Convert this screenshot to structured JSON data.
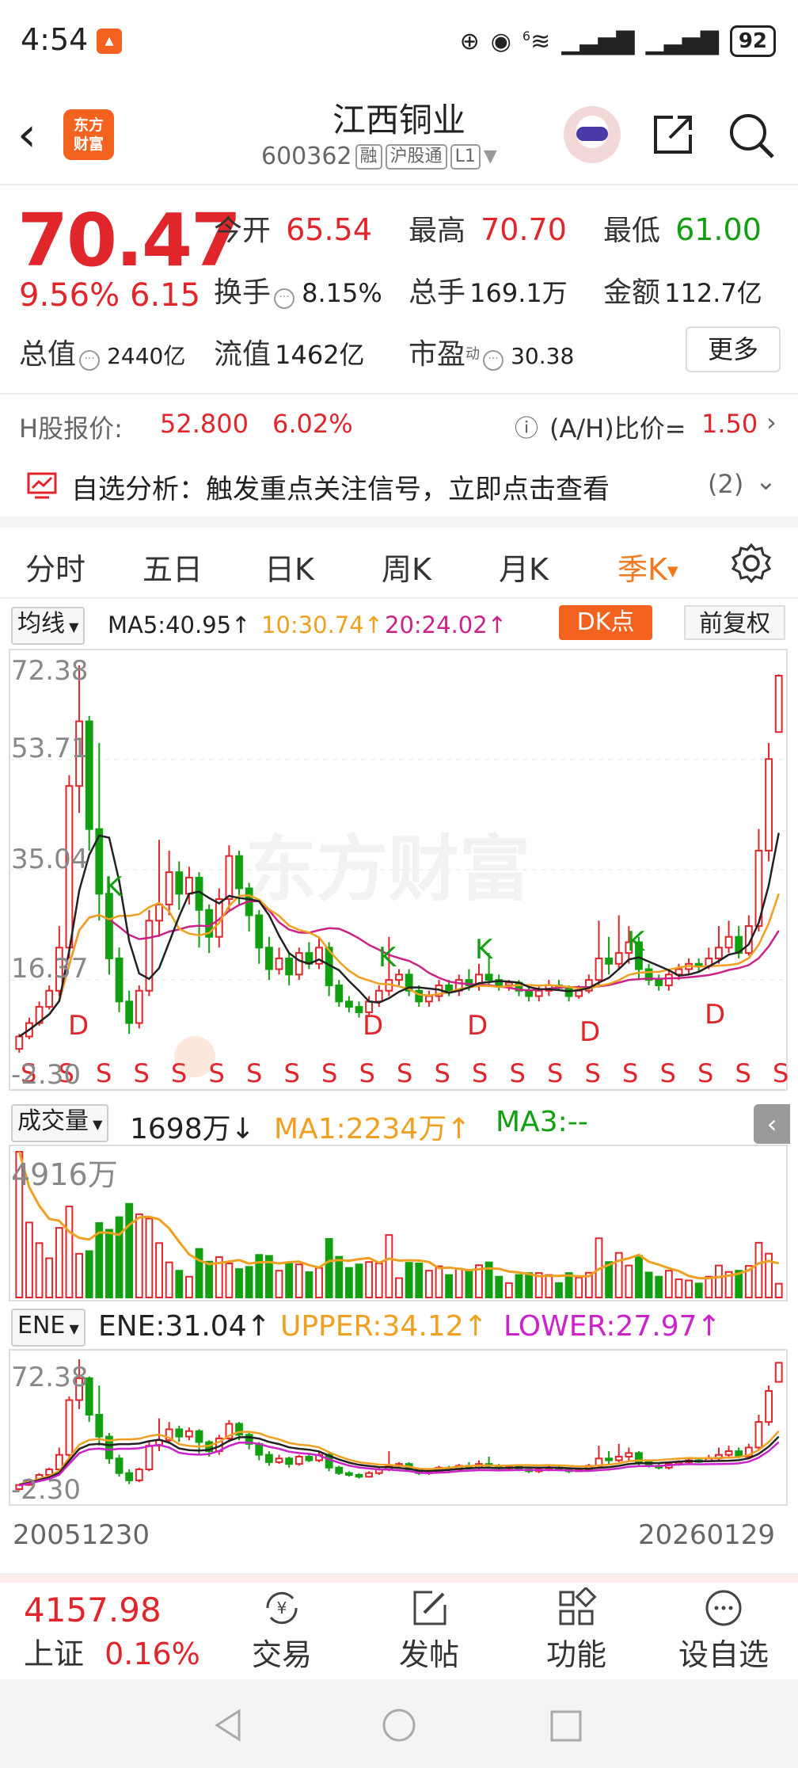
{
  "status_bar": {
    "time": "4:54",
    "network": "6",
    "battery": "92"
  },
  "header": {
    "brand_line1": "东方",
    "brand_line2": "财富",
    "stock_name": "江西铜业",
    "stock_code": "600362",
    "tags": [
      "融",
      "沪股通",
      "L1"
    ]
  },
  "quote": {
    "price": "70.47",
    "change_pct": "9.56%",
    "change_amt": "6.15",
    "open_label": "今开",
    "open": "65.54",
    "high_label": "最高",
    "high": "70.70",
    "low_label": "最低",
    "low": "61.00",
    "turnover_label": "换手",
    "turnover": "8.15%",
    "volume_label": "总手",
    "volume": "169.1万",
    "amount_label": "金额",
    "amount": "112.7亿",
    "mktcap_label": "总值",
    "mktcap": "2440亿",
    "float_label": "流值",
    "float_cap": "1462亿",
    "pe_label": "市盈",
    "pe_sup": "动",
    "pe": "30.38",
    "more_label": "更多"
  },
  "hshare": {
    "label": "H股报价:",
    "price": "52.800",
    "pct": "6.02%",
    "ratio_label": "(A/H)比价=",
    "ratio": "1.50"
  },
  "analysis": {
    "text": "自选分析：触发重点关注信号，立即点击查看",
    "count": "(2)"
  },
  "period_tabs": [
    "分时",
    "五日",
    "日K",
    "周K",
    "月K",
    "季K"
  ],
  "active_tab": "季K",
  "ma_legend": {
    "dropdown": "均线",
    "ma5": "MA5:40.95↑",
    "ma10": "10:30.74↑",
    "ma20": "20:24.02↑",
    "dk_label": "DK点",
    "adjust_label": "前复权"
  },
  "price_axis": {
    "top": "72.38",
    "l2": "53.71",
    "l3": "35.04",
    "l4": "16.37",
    "bottom": "-2.30"
  },
  "watermark": "东方财富",
  "volume_legend": {
    "dropdown": "成交量",
    "value": "1698万↓",
    "ma1": "MA1:2234万↑",
    "ma3": "MA3:--",
    "axis_top": "4916万"
  },
  "ene_legend": {
    "dropdown": "ENE",
    "ene": "ENE:31.04↑",
    "upper": "UPPER:34.12↑",
    "lower": "LOWER:27.97↑",
    "axis_top": "72.38",
    "axis_bottom": "-2.30"
  },
  "dates": {
    "start": "20051230",
    "end": "20260129"
  },
  "bottom_nav": {
    "index_value": "4157.98",
    "index_name": "上证",
    "index_pct": "0.16%",
    "items": [
      "交易",
      "发帖",
      "功能",
      "设自选"
    ]
  },
  "colors": {
    "up": "#e0262b",
    "down": "#12a012",
    "accent": "#f4621f",
    "ma5": "#222222",
    "ma10": "#f0a020",
    "ma20": "#cc2288"
  },
  "chart_data": {
    "type": "candlestick",
    "period": "quarterly",
    "y_range": [
      -2.3,
      72.38
    ],
    "y_ticks": [
      "72.38",
      "53.71",
      "35.04",
      "16.37",
      "-2.30"
    ],
    "x_range": [
      "20051230",
      "20260129"
    ],
    "signal_markers": [
      "K",
      "D",
      "S"
    ],
    "series": [
      {
        "name": "MA5",
        "latest": 40.95
      },
      {
        "name": "MA10",
        "latest": 30.74
      },
      {
        "name": "MA20",
        "latest": 24.02
      }
    ],
    "candles": [
      {
        "o": 1.2,
        "c": 3.5,
        "h": 4.0,
        "l": 0.5
      },
      {
        "o": 3.5,
        "c": 6.0,
        "h": 7.0,
        "l": 3.0
      },
      {
        "o": 6.0,
        "c": 9.0,
        "h": 10.0,
        "l": 5.5
      },
      {
        "o": 9.0,
        "c": 12.0,
        "h": 13.0,
        "l": 8.5
      },
      {
        "o": 12.0,
        "c": 20.0,
        "h": 24.0,
        "l": 11.0
      },
      {
        "o": 20.0,
        "c": 50.0,
        "h": 52.0,
        "l": 18.0
      },
      {
        "o": 50.0,
        "c": 62.0,
        "h": 72.38,
        "l": 45.0
      },
      {
        "o": 62.0,
        "c": 42.0,
        "h": 63.0,
        "l": 38.0
      },
      {
        "o": 42.0,
        "c": 30.0,
        "h": 58.0,
        "l": 25.0
      },
      {
        "o": 30.0,
        "c": 18.0,
        "h": 32.0,
        "l": 15.0
      },
      {
        "o": 18.0,
        "c": 10.0,
        "h": 20.0,
        "l": 8.0
      },
      {
        "o": 10.0,
        "c": 6.0,
        "h": 12.0,
        "l": 4.0
      },
      {
        "o": 6.0,
        "c": 12.0,
        "h": 13.0,
        "l": 5.0
      },
      {
        "o": 12.0,
        "c": 25.0,
        "h": 27.0,
        "l": 11.0
      },
      {
        "o": 25.0,
        "c": 28.0,
        "h": 40.0,
        "l": 22.0
      },
      {
        "o": 28.0,
        "c": 34.0,
        "h": 38.0,
        "l": 26.0
      },
      {
        "o": 34.0,
        "c": 30.0,
        "h": 36.0,
        "l": 27.0
      },
      {
        "o": 30.0,
        "c": 33.0,
        "h": 35.0,
        "l": 28.0
      },
      {
        "o": 33.0,
        "c": 27.0,
        "h": 34.0,
        "l": 20.0
      },
      {
        "o": 27.0,
        "c": 22.0,
        "h": 28.0,
        "l": 19.0
      },
      {
        "o": 22.0,
        "c": 29.0,
        "h": 31.0,
        "l": 20.0
      },
      {
        "o": 29.0,
        "c": 37.0,
        "h": 39.0,
        "l": 27.0
      },
      {
        "o": 37.0,
        "c": 31.0,
        "h": 38.0,
        "l": 28.0
      },
      {
        "o": 31.0,
        "c": 26.0,
        "h": 32.0,
        "l": 23.0
      },
      {
        "o": 26.0,
        "c": 20.0,
        "h": 27.0,
        "l": 17.0
      },
      {
        "o": 20.0,
        "c": 16.0,
        "h": 22.0,
        "l": 14.0
      },
      {
        "o": 16.0,
        "c": 18.0,
        "h": 20.0,
        "l": 15.0
      },
      {
        "o": 18.0,
        "c": 15.0,
        "h": 19.0,
        "l": 13.0
      },
      {
        "o": 15.0,
        "c": 19.0,
        "h": 20.0,
        "l": 14.0
      },
      {
        "o": 19.0,
        "c": 17.0,
        "h": 21.0,
        "l": 16.0
      },
      {
        "o": 17.0,
        "c": 20.0,
        "h": 22.0,
        "l": 16.0
      },
      {
        "o": 20.0,
        "c": 13.0,
        "h": 21.0,
        "l": 11.0
      },
      {
        "o": 13.0,
        "c": 10.0,
        "h": 14.0,
        "l": 9.0
      },
      {
        "o": 10.0,
        "c": 9.0,
        "h": 11.0,
        "l": 8.0
      },
      {
        "o": 9.0,
        "c": 8.0,
        "h": 10.0,
        "l": 7.0
      },
      {
        "o": 8.0,
        "c": 10.0,
        "h": 11.0,
        "l": 7.5
      },
      {
        "o": 10.0,
        "c": 12.0,
        "h": 13.0,
        "l": 9.0
      },
      {
        "o": 12.0,
        "c": 14.0,
        "h": 22.0,
        "l": 11.0
      },
      {
        "o": 14.0,
        "c": 15.0,
        "h": 16.0,
        "l": 13.0
      },
      {
        "o": 15.0,
        "c": 12.0,
        "h": 16.0,
        "l": 11.0
      },
      {
        "o": 12.0,
        "c": 10.0,
        "h": 13.0,
        "l": 9.0
      },
      {
        "o": 10.0,
        "c": 11.0,
        "h": 12.0,
        "l": 9.0
      },
      {
        "o": 11.0,
        "c": 13.0,
        "h": 14.0,
        "l": 10.0
      },
      {
        "o": 13.0,
        "c": 12.0,
        "h": 14.0,
        "l": 11.0
      },
      {
        "o": 12.0,
        "c": 14.0,
        "h": 15.0,
        "l": 11.0
      },
      {
        "o": 14.0,
        "c": 13.0,
        "h": 16.0,
        "l": 12.0
      },
      {
        "o": 13.0,
        "c": 15.0,
        "h": 17.0,
        "l": 12.0
      },
      {
        "o": 15.0,
        "c": 14.0,
        "h": 19.0,
        "l": 13.0
      },
      {
        "o": 14.0,
        "c": 13.0,
        "h": 15.0,
        "l": 12.0
      },
      {
        "o": 13.0,
        "c": 13.5,
        "h": 14.0,
        "l": 12.0
      },
      {
        "o": 13.5,
        "c": 12.0,
        "h": 14.0,
        "l": 11.0
      },
      {
        "o": 12.0,
        "c": 11.0,
        "h": 13.0,
        "l": 10.0
      },
      {
        "o": 11.0,
        "c": 12.0,
        "h": 13.0,
        "l": 10.0
      },
      {
        "o": 12.0,
        "c": 13.0,
        "h": 14.0,
        "l": 11.0
      },
      {
        "o": 13.0,
        "c": 12.5,
        "h": 14.0,
        "l": 12.0
      },
      {
        "o": 12.5,
        "c": 11.0,
        "h": 13.0,
        "l": 10.0
      },
      {
        "o": 11.0,
        "c": 12.0,
        "h": 13.0,
        "l": 10.5
      },
      {
        "o": 12.0,
        "c": 14.0,
        "h": 15.0,
        "l": 11.5
      },
      {
        "o": 14.0,
        "c": 18.0,
        "h": 25.0,
        "l": 13.0
      },
      {
        "o": 18.0,
        "c": 17.0,
        "h": 22.0,
        "l": 15.0
      },
      {
        "o": 17.0,
        "c": 19.0,
        "h": 26.0,
        "l": 16.0
      },
      {
        "o": 19.0,
        "c": 21.0,
        "h": 24.0,
        "l": 17.0
      },
      {
        "o": 21.0,
        "c": 16.0,
        "h": 22.0,
        "l": 14.0
      },
      {
        "o": 16.0,
        "c": 14.0,
        "h": 17.0,
        "l": 13.0
      },
      {
        "o": 14.0,
        "c": 13.0,
        "h": 15.0,
        "l": 12.0
      },
      {
        "o": 13.0,
        "c": 15.0,
        "h": 16.0,
        "l": 12.0
      },
      {
        "o": 15.0,
        "c": 16.0,
        "h": 17.0,
        "l": 14.0
      },
      {
        "o": 16.0,
        "c": 17.0,
        "h": 18.0,
        "l": 15.0
      },
      {
        "o": 17.0,
        "c": 16.5,
        "h": 18.0,
        "l": 15.5
      },
      {
        "o": 16.5,
        "c": 18.0,
        "h": 20.0,
        "l": 16.0
      },
      {
        "o": 18.0,
        "c": 20.0,
        "h": 24.0,
        "l": 17.0
      },
      {
        "o": 20.0,
        "c": 22.0,
        "h": 25.0,
        "l": 19.0
      },
      {
        "o": 22.0,
        "c": 19.0,
        "h": 24.0,
        "l": 18.0
      },
      {
        "o": 19.0,
        "c": 24.0,
        "h": 26.0,
        "l": 18.5
      },
      {
        "o": 24.0,
        "c": 38.0,
        "h": 42.0,
        "l": 23.0
      },
      {
        "o": 38.0,
        "c": 55.0,
        "h": 58.0,
        "l": 36.0
      },
      {
        "o": 60.0,
        "c": 70.47,
        "h": 70.7,
        "l": 61.0
      }
    ]
  }
}
